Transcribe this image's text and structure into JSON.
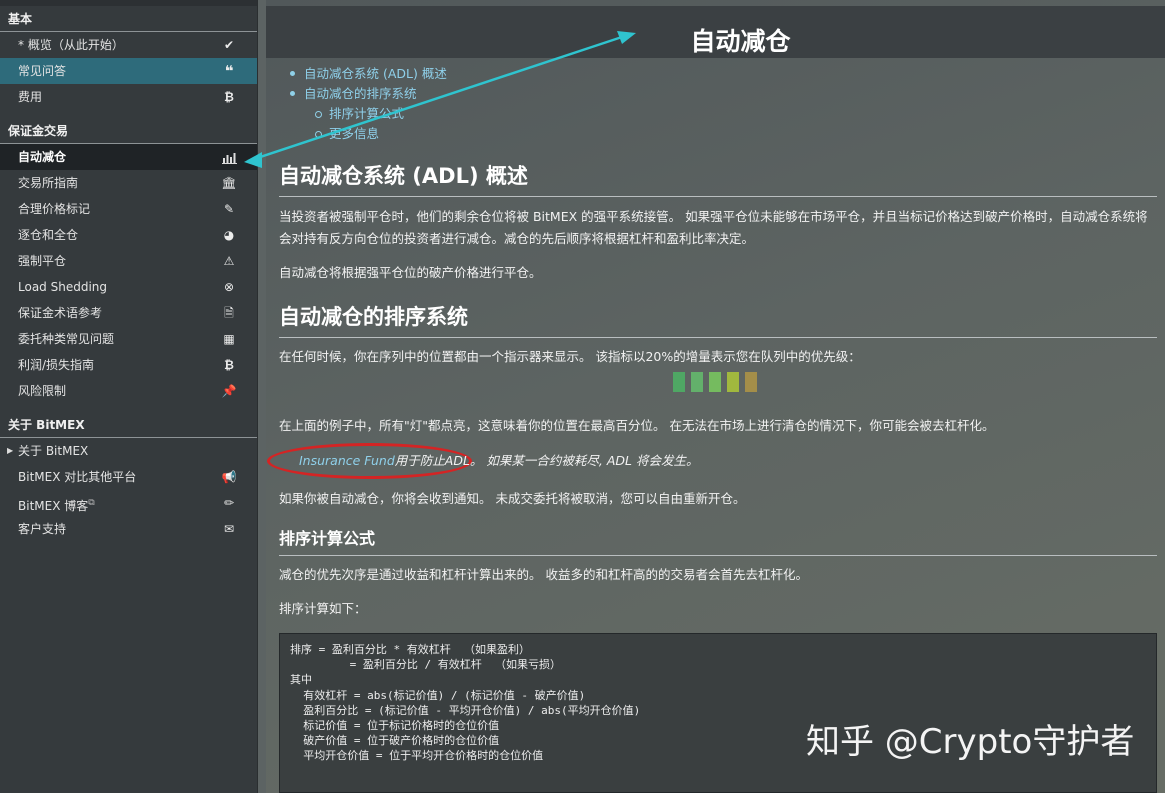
{
  "sidebar": {
    "sections": [
      {
        "title": "基本",
        "items": [
          {
            "label": "* 概览（从此开始）",
            "icon": "check-icon"
          },
          {
            "label": "常见问答",
            "icon": "quote-icon"
          },
          {
            "label": "费用",
            "icon": "bitcoin-icon"
          }
        ]
      },
      {
        "title": "保证金交易",
        "items": [
          {
            "label": "自动减仓",
            "icon": "bar-chart-icon"
          },
          {
            "label": "交易所指南",
            "icon": "bank-icon"
          },
          {
            "label": "合理价格标记",
            "icon": "edit-icon"
          },
          {
            "label": "逐仓和全仓",
            "icon": "pie-chart-icon"
          },
          {
            "label": "强制平仓",
            "icon": "warning-icon"
          },
          {
            "label": "Load Shedding",
            "icon": "close-circle-icon"
          },
          {
            "label": "保证金术语参考",
            "icon": "document-icon"
          },
          {
            "label": "委托种类常见问题",
            "icon": "calculator-icon"
          },
          {
            "label": "利润/损失指南",
            "icon": "bitcoin-icon"
          },
          {
            "label": "风险限制",
            "icon": "pin-icon"
          }
        ]
      },
      {
        "title": "关于 BitMEX",
        "items": [
          {
            "label": "关于 BitMEX",
            "icon": "caret-right-icon"
          },
          {
            "label": "BitMEX 对比其他平台",
            "icon": "megaphone-icon"
          },
          {
            "label": "BitMEX 博客",
            "icon": "pencil-icon"
          },
          {
            "label": "客户支持",
            "icon": "envelope-icon"
          }
        ]
      }
    ]
  },
  "main": {
    "title": "自动减仓",
    "toc": [
      {
        "label": "自动减仓系统 (ADL) 概述"
      },
      {
        "label": "自动减仓的排序系统"
      },
      {
        "label": "排序计算公式"
      },
      {
        "label": "更多信息"
      }
    ],
    "h_overview": "自动减仓系统 (ADL) 概述",
    "p_overview_1": "当投资者被强制平仓时，他们的剩余仓位将被 BitMEX 的强平系统接管。 如果强平仓位未能够在市场平仓，并且当标记价格达到破产价格时，自动减仓系统将会对持有反方向仓位的投资者进行减仓。减仓的先后顺序将根据杠杆和盈利比率决定。",
    "p_overview_2": "自动减仓将根据强平仓位的破产价格进行平仓。",
    "h_ranking": "自动减仓的排序系统",
    "p_ranking_1": "在任何时候，你在序列中的位置都由一个指示器来显示。 该指标以20%的增量表示您在队列中的优先级：",
    "adl_indicator": {
      "lit_count": 5,
      "colors": [
        "#4fa764",
        "#63b06b",
        "#75bb5f",
        "#a1b83e",
        "#a48e49"
      ]
    },
    "p_ranking_2": "在上面的例子中，所有\"灯\"都点亮，这意味着你的位置在最高百分位。 在无法在市场上进行清仓的情况下，你可能会被去杠杆化。",
    "insurance_link": "Insurance Fund",
    "insurance_text_1": "用于防止ADL。",
    "insurance_text_2": " 如果某一合约被耗尽, ADL 将会发生。",
    "p_ranking_3": "如果你被自动减仓，你将会收到通知。 未成交委托将被取消，您可以自由重新开仓。",
    "h_formula": "排序计算公式",
    "p_formula_1": "减仓的优先次序是通过收益和杠杆计算出来的。 收益多的和杠杆高的的交易者会首先去杠杆化。",
    "p_formula_2": "排序计算如下：",
    "code": "排序 = 盈利百分比 * 有效杠杆  （如果盈利）\n         = 盈利百分比 / 有效杠杆  （如果亏损）\n其中\n  有效杠杆 = abs(标记价值) / (标记价值 - 破产价值)\n  盈利百分比 = (标记价值 - 平均开仓价值) / abs(平均开仓价值)\n  标记价值 = 位于标记价格时的仓位价值\n  破产价值 = 位于破产价格时的仓位价值\n  平均开仓价值 = 位于平均开仓价格时的仓位价值"
  },
  "watermark": "知乎 @Crypto守护者",
  "colors": {
    "annotation_red": "#d42424",
    "annotation_arrow": "#2fc4cf",
    "link": "#8fd0ea",
    "sidebar_highlight": "#2e6b7b",
    "sidebar_active": "#1f2326"
  }
}
